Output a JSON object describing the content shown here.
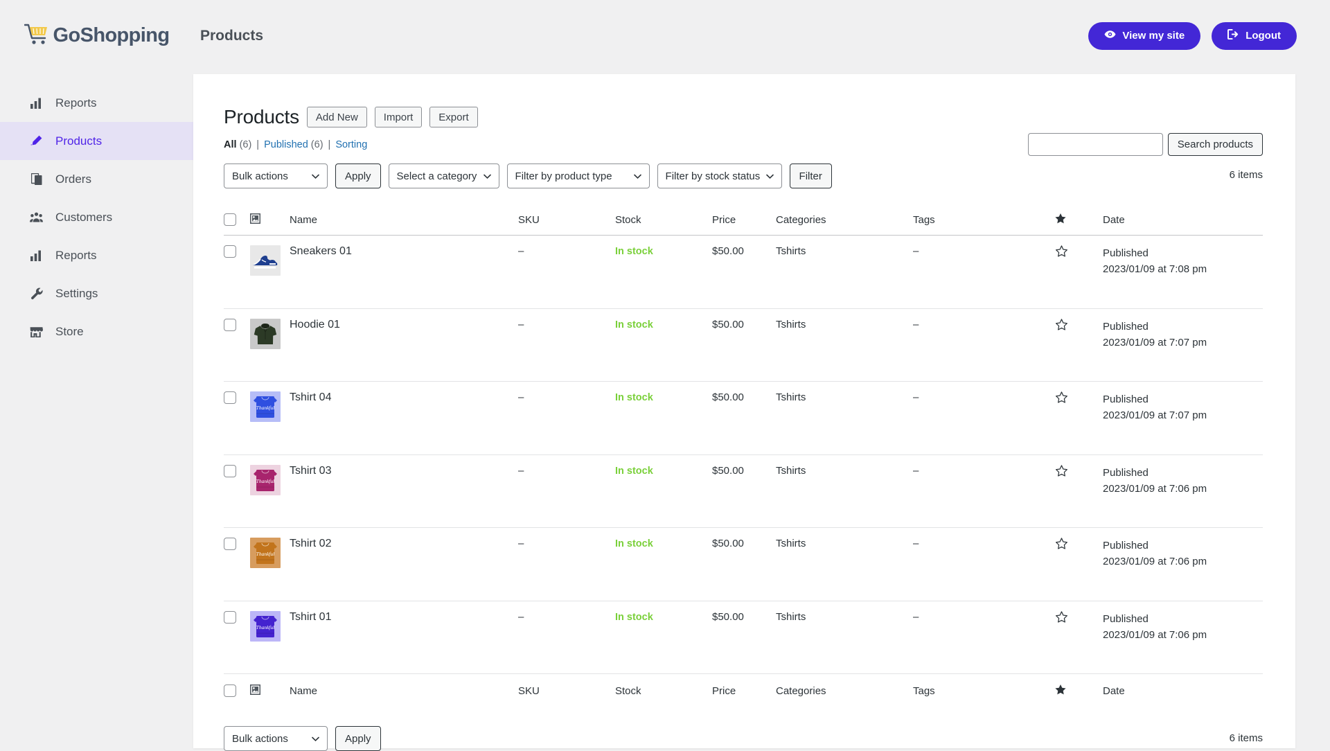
{
  "brand": {
    "name": "GoShopping",
    "logo_icon": "shopping-cart-icon"
  },
  "topbar": {
    "title": "Products",
    "view_site_label": "View my site",
    "view_site_icon": "eye-icon",
    "logout_label": "Logout",
    "logout_icon": "sign-out-icon",
    "accent_color": "#4327d6"
  },
  "sidebar": {
    "active_bg": "#e5e1f5",
    "active_color": "#5024e8",
    "items": [
      {
        "label": "Reports",
        "icon": "bar-chart-icon",
        "active": false
      },
      {
        "label": "Products",
        "icon": "pencil-icon",
        "active": true
      },
      {
        "label": "Orders",
        "icon": "pages-icon",
        "active": false
      },
      {
        "label": "Customers",
        "icon": "people-icon",
        "active": false
      },
      {
        "label": "Reports",
        "icon": "bar-chart-icon",
        "active": false
      },
      {
        "label": "Settings",
        "icon": "wrench-icon",
        "active": false
      },
      {
        "label": "Store",
        "icon": "storefront-icon",
        "active": false
      }
    ]
  },
  "page": {
    "heading": "Products",
    "actions": [
      {
        "label": "Add New"
      },
      {
        "label": "Import"
      },
      {
        "label": "Export"
      }
    ],
    "views": {
      "all_label": "All",
      "all_count": "(6)",
      "published_label": "Published",
      "published_count": "(6)",
      "sorting_label": "Sorting",
      "separator": "|"
    }
  },
  "search": {
    "value": "",
    "placeholder": "",
    "button_label": "Search products"
  },
  "toolbar": {
    "bulk_actions_label": "Bulk actions",
    "apply_label": "Apply",
    "category_label": "Select a category",
    "product_type_label": "Filter by product type",
    "stock_status_label": "Filter by stock status",
    "filter_label": "Filter",
    "items_count": "6 items"
  },
  "toolbar_bottom": {
    "bulk_actions_label": "Bulk actions",
    "apply_label": "Apply",
    "items_count": "6 items"
  },
  "table": {
    "columns": {
      "checkbox": "",
      "image": "",
      "name": "Name",
      "sku": "SKU",
      "stock": "Stock",
      "price": "Price",
      "categories": "Categories",
      "tags": "Tags",
      "featured": "",
      "date": "Date"
    },
    "column_icons": {
      "image": "image-icon",
      "featured": "star-filled-icon"
    },
    "stock_color": "#7ad03a",
    "rows": [
      {
        "name": "Sneakers 01",
        "sku": "–",
        "stock": "In stock",
        "price": "$50.00",
        "categories": "Tshirts",
        "tags": "–",
        "featured": false,
        "date_status": "Published",
        "date_value": "2023/01/09 at 7:08 pm",
        "thumb": {
          "kind": "sneaker",
          "bg": "#e8e8e8",
          "color": "#1f3f8f",
          "accent": "#ffffff"
        }
      },
      {
        "name": "Hoodie 01",
        "sku": "–",
        "stock": "In stock",
        "price": "$50.00",
        "categories": "Tshirts",
        "tags": "–",
        "featured": false,
        "date_status": "Published",
        "date_value": "2023/01/09 at 7:07 pm",
        "thumb": {
          "kind": "hoodie",
          "bg": "#c9c9c9",
          "color": "#2c3a26",
          "accent": "#1d2619"
        }
      },
      {
        "name": "Tshirt 04",
        "sku": "–",
        "stock": "In stock",
        "price": "$50.00",
        "categories": "Tshirts",
        "tags": "–",
        "featured": false,
        "date_status": "Published",
        "date_value": "2023/01/09 at 7:07 pm",
        "thumb": {
          "kind": "tshirt",
          "bg": "#b6bdf7",
          "color": "#2f4fe0",
          "accent": "#ffffff",
          "print": "Thankful"
        }
      },
      {
        "name": "Tshirt 03",
        "sku": "–",
        "stock": "In stock",
        "price": "$50.00",
        "categories": "Tshirts",
        "tags": "–",
        "featured": false,
        "date_status": "Published",
        "date_value": "2023/01/09 at 7:06 pm",
        "thumb": {
          "kind": "tshirt",
          "bg": "#edd3e0",
          "color": "#a8246d",
          "accent": "#ffffff",
          "print": "Thankful"
        }
      },
      {
        "name": "Tshirt 02",
        "sku": "–",
        "stock": "In stock",
        "price": "$50.00",
        "categories": "Tshirts",
        "tags": "–",
        "featured": false,
        "date_status": "Published",
        "date_value": "2023/01/09 at 7:06 pm",
        "thumb": {
          "kind": "tshirt",
          "bg": "#d79c5e",
          "color": "#c2741c",
          "accent": "#ffffff",
          "print": "Thankful"
        }
      },
      {
        "name": "Tshirt 01",
        "sku": "–",
        "stock": "In stock",
        "price": "$50.00",
        "categories": "Tshirts",
        "tags": "–",
        "featured": false,
        "date_status": "Published",
        "date_value": "2023/01/09 at 7:06 pm",
        "thumb": {
          "kind": "tshirt",
          "bg": "#bcb6f7",
          "color": "#4423cf",
          "accent": "#ffffff",
          "print": "Thankful"
        }
      }
    ]
  }
}
